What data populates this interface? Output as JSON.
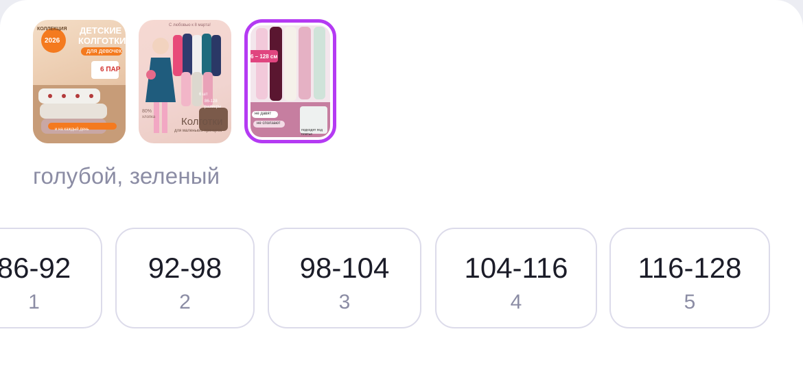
{
  "thumbnails": [
    {
      "lines": [
        "ДЕТСКИЕ",
        "КОЛГОТКИ",
        "для девочек"
      ],
      "badge": "2026",
      "badge_top": "КОЛЛЕКЦИЯ",
      "pack": "6 ПАР",
      "footer": "и на каждый день",
      "selected": false
    },
    {
      "top": "С любовью к 8 марта!",
      "title": "Колготки",
      "subtitle": "для маленьких принцесс",
      "percent": "80%",
      "percent_sub": "хлопка",
      "count": "6 шт",
      "range": "86-128",
      "range_sub": "размеры",
      "selected": false
    },
    {
      "range": "6 – 128 см",
      "chip1": "не давят",
      "chip2": "не сползают",
      "note": "подходят под платье",
      "selected": true
    }
  ],
  "color_label": "голубой, зеленый",
  "sizes": [
    {
      "range": "86-92",
      "count": "1"
    },
    {
      "range": "92-98",
      "count": "2"
    },
    {
      "range": "98-104",
      "count": "3"
    },
    {
      "range": "104-116",
      "count": "4"
    },
    {
      "range": "116-128",
      "count": "5"
    }
  ],
  "colors": {
    "accent": "#b43af3",
    "muted": "#8b8ca4",
    "border": "#dcdbea"
  }
}
